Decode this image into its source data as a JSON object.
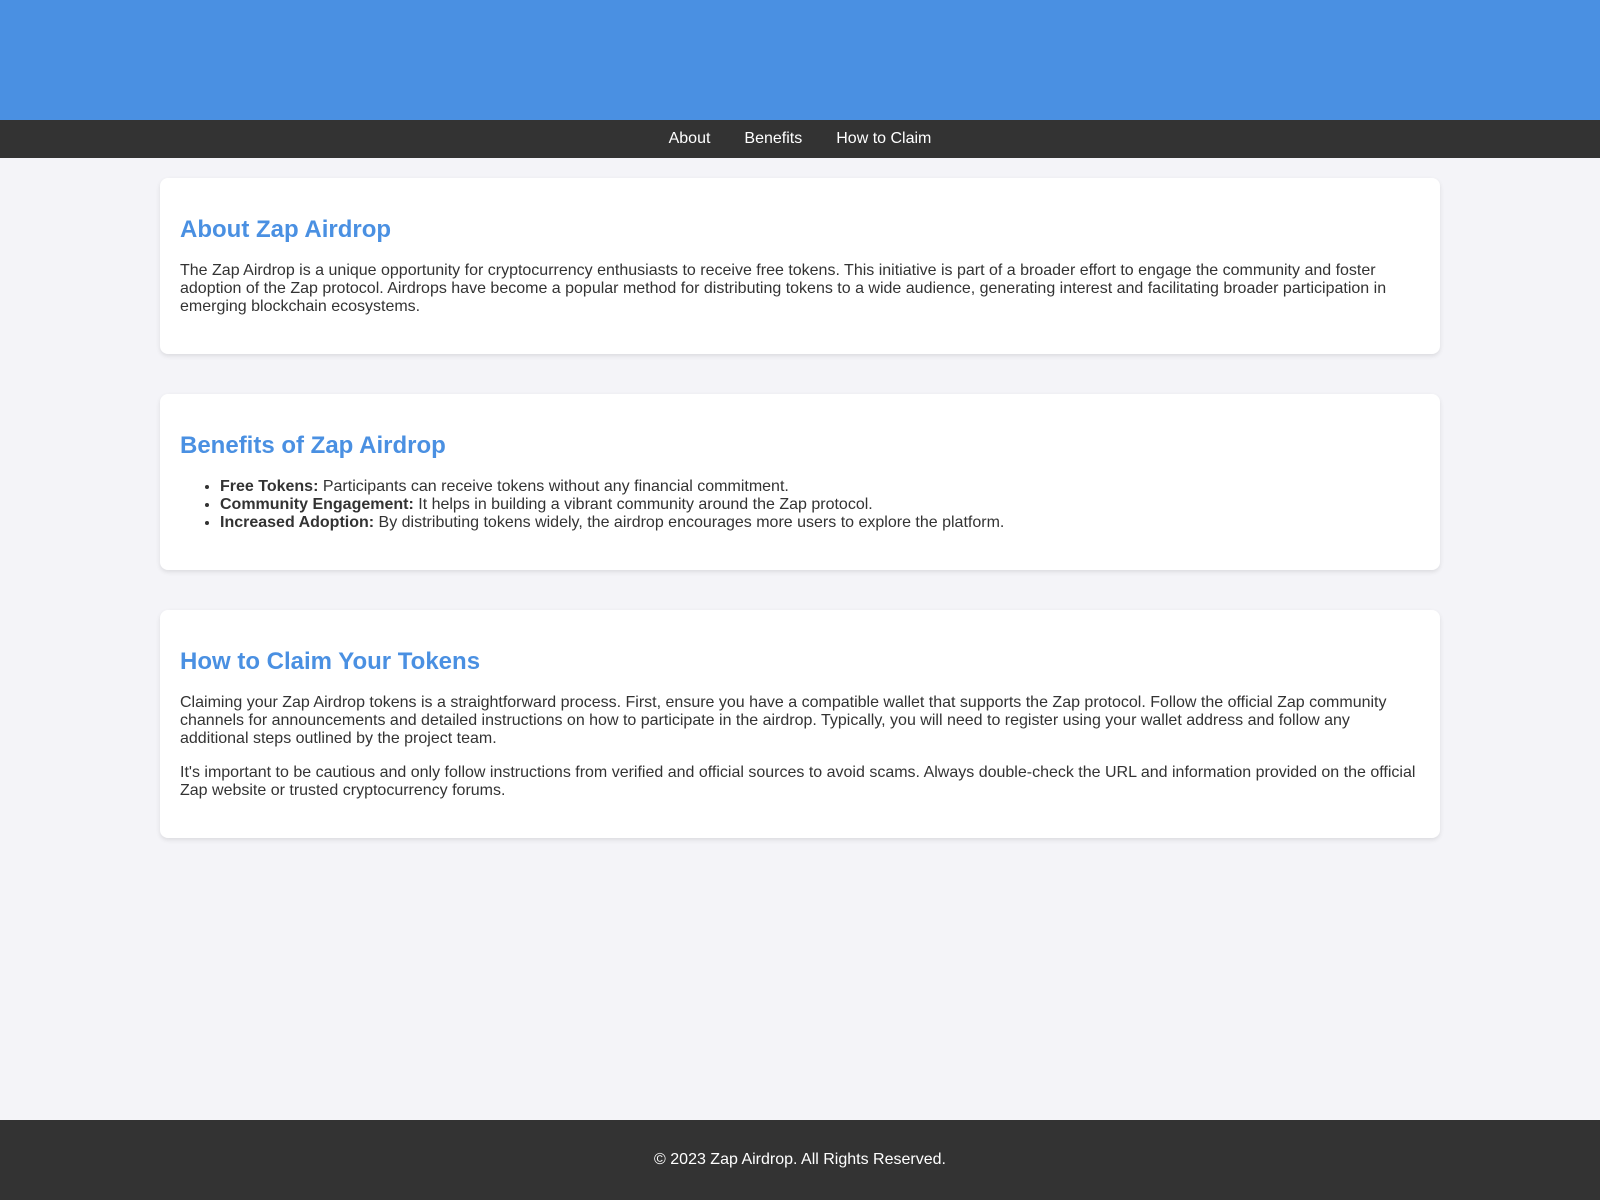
{
  "nav": {
    "items": [
      {
        "label": "About"
      },
      {
        "label": "Benefits"
      },
      {
        "label": "How to Claim"
      }
    ]
  },
  "about": {
    "title": "About Zap Airdrop",
    "text": "The Zap Airdrop is a unique opportunity for cryptocurrency enthusiasts to receive free tokens. This initiative is part of a broader effort to engage the community and foster adoption of the Zap protocol. Airdrops have become a popular method for distributing tokens to a wide audience, generating interest and facilitating broader participation in emerging blockchain ecosystems."
  },
  "benefits": {
    "title": "Benefits of Zap Airdrop",
    "items": [
      {
        "label": "Free Tokens:",
        "text": " Participants can receive tokens without any financial commitment."
      },
      {
        "label": "Community Engagement:",
        "text": " It helps in building a vibrant community around the Zap protocol."
      },
      {
        "label": "Increased Adoption:",
        "text": " By distributing tokens widely, the airdrop encourages more users to explore the platform."
      }
    ]
  },
  "claim": {
    "title": "How to Claim Your Tokens",
    "paragraphs": [
      "Claiming your Zap Airdrop tokens is a straightforward process. First, ensure you have a compatible wallet that supports the Zap protocol. Follow the official Zap community channels for announcements and detailed instructions on how to participate in the airdrop. Typically, you will need to register using your wallet address and follow any additional steps outlined by the project team.",
      "It's important to be cautious and only follow instructions from verified and official sources to avoid scams. Always double-check the URL and information provided on the official Zap website or trusted cryptocurrency forums."
    ]
  },
  "footer": {
    "text": "© 2023 Zap Airdrop. All Rights Reserved."
  },
  "colors": {
    "accent": "#4a90e2",
    "dark": "#333333",
    "background": "#f4f4f8"
  }
}
